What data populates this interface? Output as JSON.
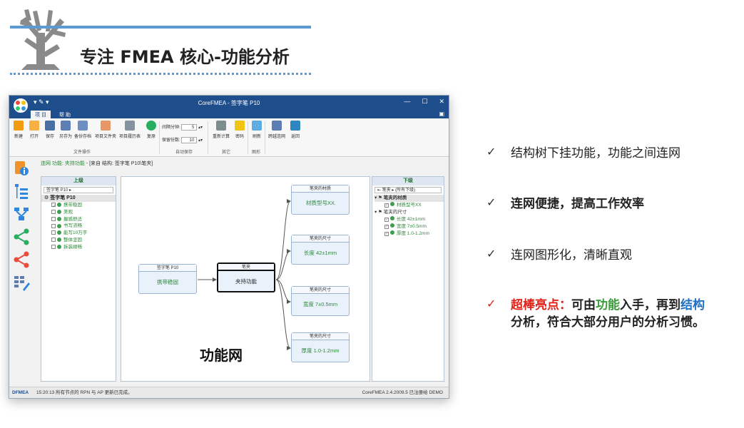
{
  "slide": {
    "title": "专注 FMEA 核心-功能分析",
    "accent_color": "#5b9bd5"
  },
  "window": {
    "title": "CoreFMEA - 签字笔 P10",
    "controls": [
      "—",
      "☐",
      "✕"
    ],
    "tabs": [
      {
        "label": "项 目",
        "active": true
      },
      {
        "label": "帮 助",
        "active": false
      }
    ],
    "ribbon": {
      "buttons": [
        "新建",
        "打开",
        "保存",
        "另存为",
        "备份存档",
        "项目文件夹",
        "项目履历表",
        "复原",
        "重新计算",
        "密码",
        "刷新",
        "跨越连网",
        "返回"
      ],
      "autosave": {
        "interval_label": "间隔分钟:",
        "interval_value": "5",
        "keep_label": "保留份数:",
        "keep_value": "10"
      },
      "groups": [
        "文件操作",
        "自动保存",
        "其它",
        "图形"
      ]
    },
    "breadcrumb": {
      "prefix": "连网 功能:",
      "function": "夹持功能",
      "source": "- [来自 结构: 签字笔 P10\\笔夹]"
    },
    "upper_panel": {
      "header": "上级",
      "select": "签字笔 P10",
      "root": "签字笔 P10",
      "items": [
        "携带稳固",
        "美观",
        "握感舒适",
        "书写流畅",
        "能写10万字",
        "整体坚固",
        "拆装顺畅"
      ]
    },
    "lower_panel": {
      "header": "下级",
      "select_left": "笔夹",
      "select_right": "(所有下级)",
      "groups": [
        {
          "name": "笔夹的材质",
          "items": [
            "材质型号XX"
          ]
        },
        {
          "name": "笔夹的尺寸",
          "items": [
            "长度 42±1mm",
            "宽度 7±0.5mm",
            "厚度 1.0-1.2mm"
          ]
        }
      ]
    },
    "network": {
      "label": "功能网",
      "left_node": {
        "header": "签字笔 P10",
        "body": "携带稳固"
      },
      "center_node": {
        "header": "笔夹",
        "body": "夹持功能"
      },
      "right_nodes": [
        {
          "header": "笔夹的材质",
          "body": "材质型号XX"
        },
        {
          "header": "笔夹的尺寸",
          "body": "长度 42±1mm"
        },
        {
          "header": "笔夹的尺寸",
          "body": "宽度 7±0.5mm"
        },
        {
          "header": "笔夹的尺寸",
          "body": "厚度 1.0-1.2mm"
        }
      ]
    },
    "status": {
      "mode": "DFMEA",
      "message": "15:20:13   所有节点的 RPN 与 AP 更新已完成。",
      "version": "CoreFMEA 2.4.2009.5  已注册给 DEMO"
    }
  },
  "bullets": [
    {
      "check": "✓",
      "text": "结构树下挂功能，功能之间连网"
    },
    {
      "check": "✓",
      "text": "连网便捷，提高工作效率"
    },
    {
      "check": "✓",
      "text": "连网图形化，清晰直观"
    },
    {
      "check": "✓",
      "highlight": "超棒亮点：",
      "t1": "可由",
      "func": "功能",
      "t2": "入手，再到",
      "struct": "结构",
      "line2": "分析，符合大部分用户的分析习惯。"
    }
  ]
}
